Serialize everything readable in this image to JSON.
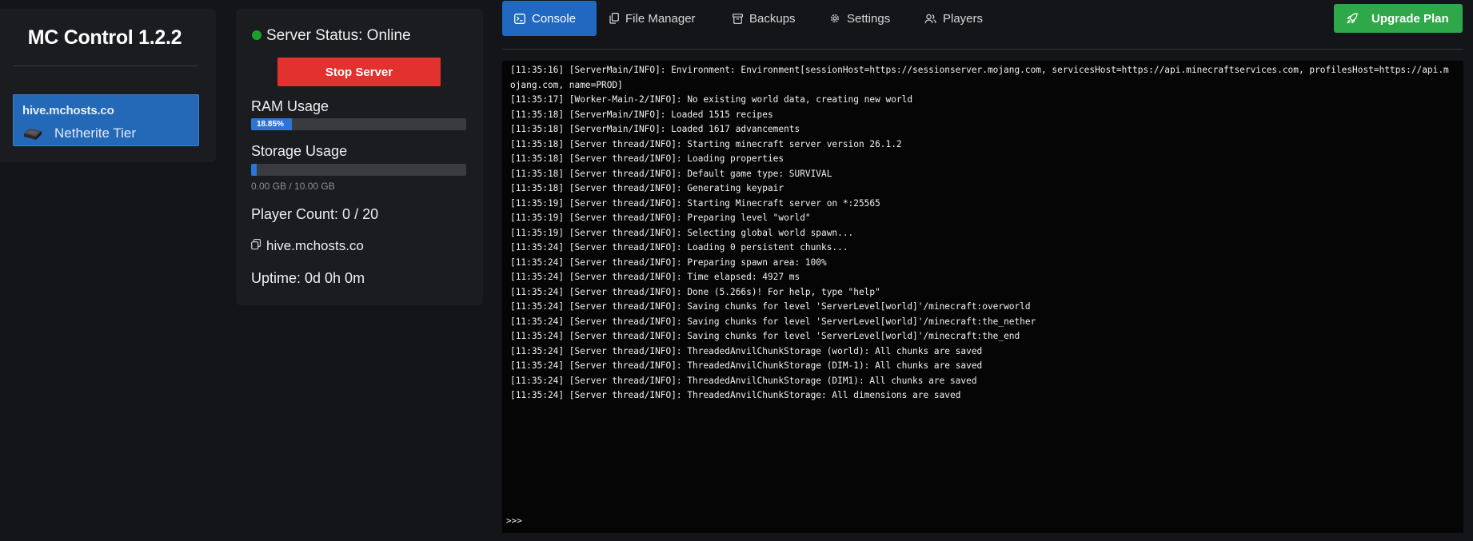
{
  "app": {
    "title": "MC Control 1.2.2"
  },
  "sidebar": {
    "server": {
      "host": "hive.mchosts.co",
      "tier": "Netherite Tier",
      "tier_icon": "netherite-ingot-icon"
    }
  },
  "status": {
    "status_text": "Server Status: Online",
    "status_color": "#1aa12a",
    "stop_label": "Stop Server",
    "ram_label": "RAM Usage",
    "ram_percent": 18.85,
    "ram_percent_text": "18.85%",
    "storage_label": "Storage Usage",
    "storage_percent": 0,
    "storage_text": "0.00 GB / 10.00 GB",
    "player_count": "Player Count: 0 / 20",
    "address": "hive.mchosts.co",
    "uptime": "Uptime: 0d 0h 0m"
  },
  "tabs": [
    {
      "label": "Console",
      "icon": "terminal-icon",
      "active": true
    },
    {
      "label": "File Manager",
      "icon": "files-icon",
      "active": false
    },
    {
      "label": "Backups",
      "icon": "archive-icon",
      "active": false
    },
    {
      "label": "Settings",
      "icon": "gear-icon",
      "active": false
    },
    {
      "label": "Players",
      "icon": "users-icon",
      "active": false
    }
  ],
  "upgrade": {
    "label": "Upgrade Plan",
    "icon": "rocket-icon"
  },
  "colors": {
    "accent": "#2068c0",
    "danger": "#e2312e",
    "success": "#2fa84a"
  },
  "console": {
    "prompt": ">>>",
    "input_value": "",
    "lines": [
      "[11:35:16] [ServerMain/INFO]: Environment: Environment[sessionHost=https://sessionserver.mojang.com, servicesHost=https://api.minecraftservices.com, profilesHost=https://api.mojang.com, name=PROD]",
      "[11:35:17] [Worker-Main-2/INFO]: No existing world data, creating new world",
      "[11:35:18] [ServerMain/INFO]: Loaded 1515 recipes",
      "[11:35:18] [ServerMain/INFO]: Loaded 1617 advancements",
      "[11:35:18] [Server thread/INFO]: Starting minecraft server version 26.1.2",
      "[11:35:18] [Server thread/INFO]: Loading properties",
      "[11:35:18] [Server thread/INFO]: Default game type: SURVIVAL",
      "[11:35:18] [Server thread/INFO]: Generating keypair",
      "[11:35:19] [Server thread/INFO]: Starting Minecraft server on *:25565",
      "[11:35:19] [Server thread/INFO]: Preparing level \"world\"",
      "[11:35:19] [Server thread/INFO]: Selecting global world spawn...",
      "[11:35:24] [Server thread/INFO]: Loading 0 persistent chunks...",
      "[11:35:24] [Server thread/INFO]: Preparing spawn area: 100%",
      "[11:35:24] [Server thread/INFO]: Time elapsed: 4927 ms",
      "[11:35:24] [Server thread/INFO]: Done (5.266s)! For help, type \"help\"",
      "[11:35:24] [Server thread/INFO]: Saving chunks for level 'ServerLevel[world]'/minecraft:overworld",
      "[11:35:24] [Server thread/INFO]: Saving chunks for level 'ServerLevel[world]'/minecraft:the_nether",
      "[11:35:24] [Server thread/INFO]: Saving chunks for level 'ServerLevel[world]'/minecraft:the_end",
      "[11:35:24] [Server thread/INFO]: ThreadedAnvilChunkStorage (world): All chunks are saved",
      "[11:35:24] [Server thread/INFO]: ThreadedAnvilChunkStorage (DIM-1): All chunks are saved",
      "[11:35:24] [Server thread/INFO]: ThreadedAnvilChunkStorage (DIM1): All chunks are saved",
      "[11:35:24] [Server thread/INFO]: ThreadedAnvilChunkStorage: All dimensions are saved"
    ]
  }
}
